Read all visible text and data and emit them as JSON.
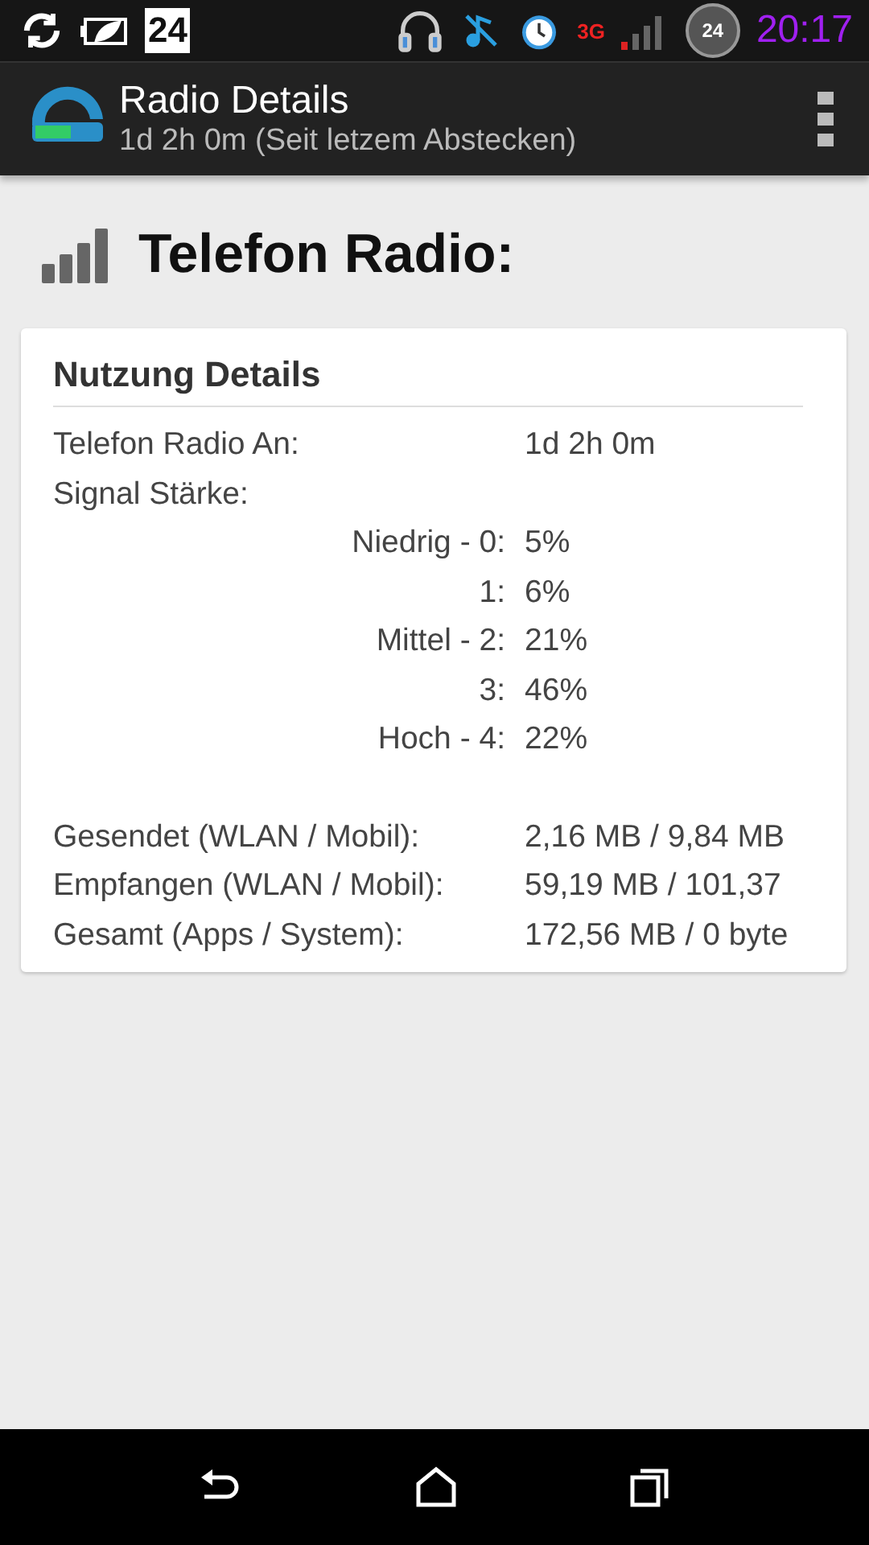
{
  "status_bar": {
    "calendar_day": "24",
    "badge_day": "24",
    "network": "3G",
    "time": "20:17"
  },
  "action_bar": {
    "title": "Radio Details",
    "subtitle": "1d 2h 0m (Seit letzem Abstecken)"
  },
  "heading": "Telefon Radio:",
  "card": {
    "title": "Nutzung Details",
    "rows": [
      {
        "kind": "plain",
        "label": "Telefon Radio An:",
        "value": "1d 2h 0m"
      },
      {
        "kind": "section",
        "label": "Signal Stärke:"
      },
      {
        "kind": "signal",
        "label": "Niedrig - 0:",
        "value": "5%"
      },
      {
        "kind": "signal",
        "label": "1:",
        "value": "6%"
      },
      {
        "kind": "signal",
        "label": "Mittel - 2:",
        "value": "21%"
      },
      {
        "kind": "signal",
        "label": "3:",
        "value": "46%"
      },
      {
        "kind": "signal",
        "label": "Hoch - 4:",
        "value": "22%"
      },
      {
        "kind": "gap"
      },
      {
        "kind": "plain",
        "label": "Gesendet (WLAN / Mobil):",
        "value": "2,16 MB / 9,84 MB"
      },
      {
        "kind": "plain",
        "label": "Empfangen (WLAN / Mobil):",
        "value": "59,19 MB / 101,37"
      },
      {
        "kind": "plain",
        "label": "Gesamt (Apps / System):",
        "value": "172,56 MB / 0 byte"
      }
    ]
  }
}
